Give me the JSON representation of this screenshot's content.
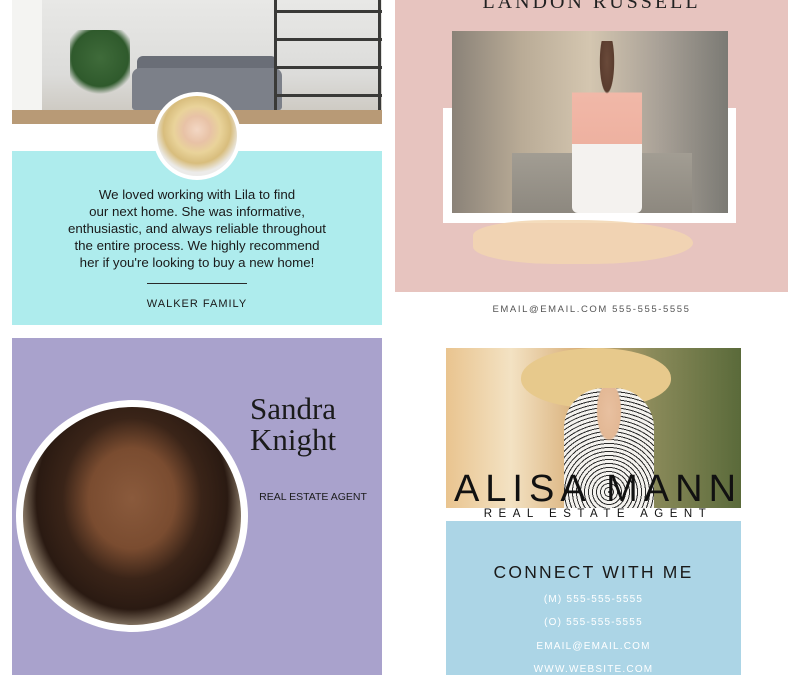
{
  "testimonial": {
    "quote_lines": [
      "We loved working with Lila to find",
      "our next home.  She was informative,",
      "enthusiastic, and always reliable throughout",
      "the entire process.  We highly recommend",
      "her if you're looking to buy a new home!"
    ],
    "signature": "WALKER FAMILY",
    "panel_color": "#aeeced"
  },
  "landon": {
    "name": "LANDON RUSSELL",
    "contact": "EMAIL@EMAIL.COM 555-555-5555",
    "background_color": "#e7c4bf"
  },
  "sandra": {
    "first_name": "Sandra",
    "last_name": "Knight",
    "role": "REAL ESTATE AGENT",
    "background_color": "#a9a2cc"
  },
  "alisa": {
    "name": "ALISA MANN",
    "role": "REAL ESTATE AGENT",
    "connect_heading": "CONNECT WITH ME",
    "mobile": "(M) 555-555-5555",
    "office": "(O) 555-555-5555",
    "email": "EMAIL@EMAIL.COM",
    "website": "WWW.WEBSITE.COM",
    "panel_color": "#acd5e6"
  }
}
